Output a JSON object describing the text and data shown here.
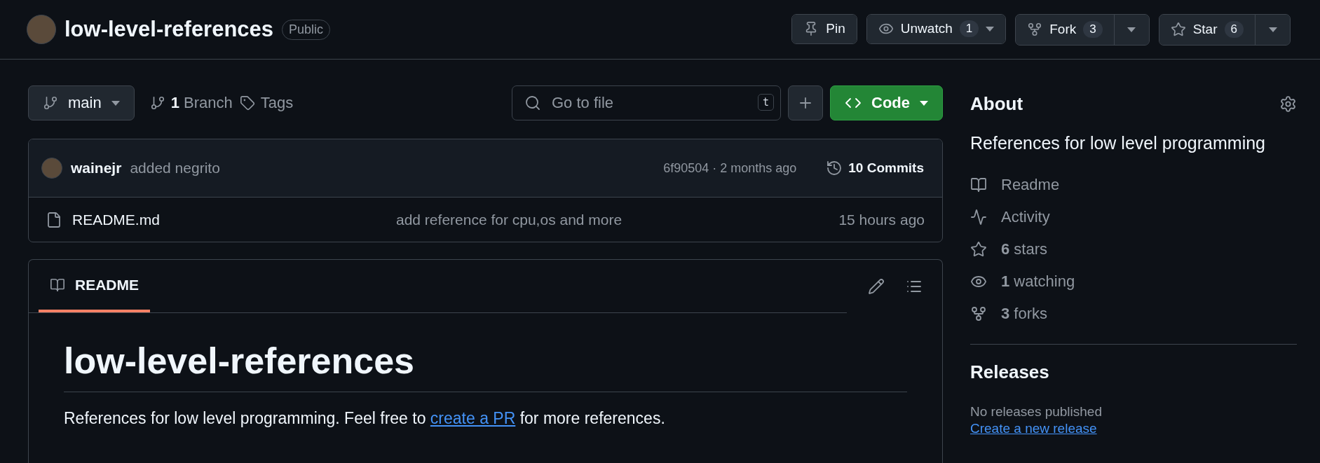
{
  "repo": {
    "title": "low-level-references",
    "visibility": "Public"
  },
  "actions": [
    {
      "kind": "pin",
      "label": "Pin",
      "caret": false,
      "split": false
    },
    {
      "kind": "watch",
      "label": "Unwatch",
      "count": "1",
      "caret": true,
      "split": false
    },
    {
      "kind": "fork",
      "label": "Fork",
      "count": "3",
      "caret": true,
      "split": true
    },
    {
      "kind": "star",
      "label": "Star",
      "count": "6",
      "caret": true,
      "split": true
    }
  ],
  "toolbar": {
    "branch": "main",
    "branch_count": "1",
    "branch_label": "Branch",
    "tags_label": "Tags",
    "search_placeholder": "Go to file",
    "search_key": "t",
    "code_label": "Code"
  },
  "latest_commit": {
    "author": "wainejr",
    "message": "added negrito",
    "meta": "6f90504 · 2 months ago",
    "commits": "10 Commits"
  },
  "files": [
    {
      "name": "README.md",
      "message": "add reference for cpu,os and more",
      "time": "15 hours ago"
    }
  ],
  "readme": {
    "tabs": [
      {
        "label": "README",
        "selected": true
      }
    ],
    "heading": "low-level-references",
    "paragraph": {
      "before": "References for low level programming. Feel free to ",
      "link": "create a PR",
      "after": " for more references."
    }
  },
  "about": {
    "title": "About",
    "description": "References for low level programming",
    "items": [
      {
        "kind": "readme",
        "label": "Readme"
      },
      {
        "kind": "activity",
        "label": "Activity"
      },
      {
        "kind": "stars",
        "label": "**6** stars"
      },
      {
        "kind": "watching",
        "label": "**1** watching"
      },
      {
        "kind": "forks",
        "label": "**3** forks"
      }
    ]
  },
  "releases": {
    "title": "Releases",
    "note": "No releases published",
    "link": "Create a new release"
  }
}
